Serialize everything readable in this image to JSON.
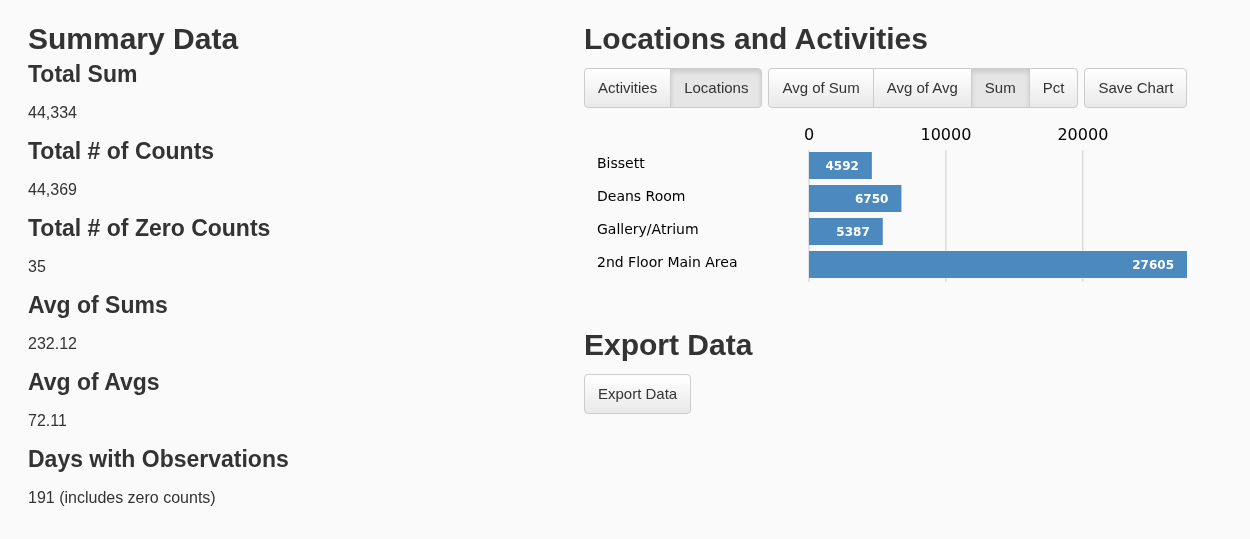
{
  "summary": {
    "title": "Summary Data",
    "stats": [
      {
        "label": "Total Sum",
        "value": "44,334"
      },
      {
        "label": "Total # of Counts",
        "value": "44,369"
      },
      {
        "label": "Total # of Zero Counts",
        "value": "35"
      },
      {
        "label": "Avg of Sums",
        "value": "232.12"
      },
      {
        "label": "Avg of Avgs",
        "value": "72.11"
      },
      {
        "label": "Days with Observations",
        "value": "191 (includes zero counts)"
      }
    ]
  },
  "locations": {
    "title": "Locations and Activities",
    "view_toggle": [
      {
        "label": "Activities",
        "selected": false
      },
      {
        "label": "Locations",
        "selected": true
      }
    ],
    "measure_toggle": [
      {
        "label": "Avg of Sum",
        "selected": false
      },
      {
        "label": "Avg of Avg",
        "selected": false
      },
      {
        "label": "Sum",
        "selected": true
      },
      {
        "label": "Pct",
        "selected": false
      }
    ],
    "save_button": "Save Chart",
    "chart_data": {
      "type": "bar",
      "orientation": "horizontal",
      "categories": [
        "Bissett",
        "Deans Room",
        "Gallery/Atrium",
        "2nd Floor Main Area"
      ],
      "values": [
        4592,
        6750,
        5387,
        27605
      ],
      "xticks": [
        0,
        10000,
        20000
      ],
      "xlim": [
        0,
        27605
      ],
      "data_labels": true
    }
  },
  "export": {
    "title": "Export Data",
    "button": "Export Data"
  }
}
